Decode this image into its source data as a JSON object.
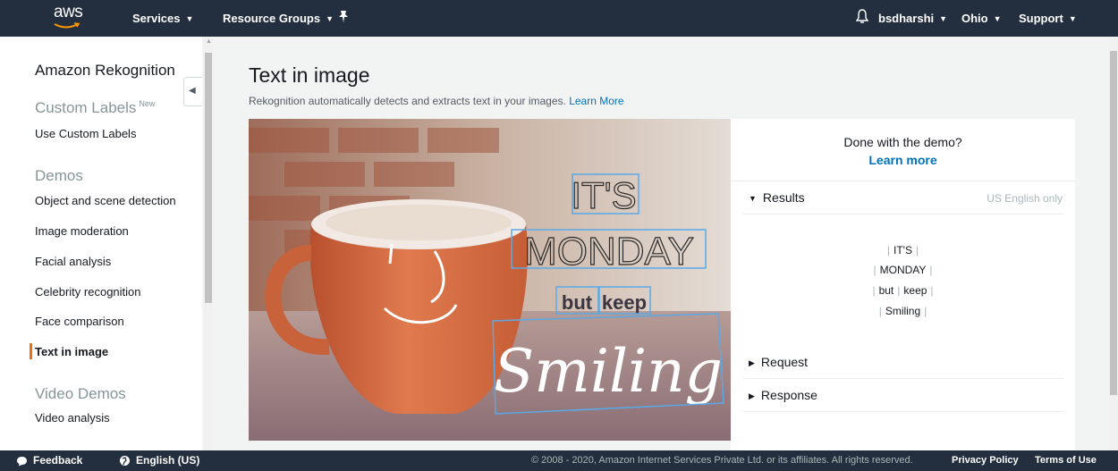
{
  "nav": {
    "logo_text": "aws",
    "services": "Services",
    "resource_groups": "Resource Groups",
    "user": "bsdharshi",
    "region": "Ohio",
    "support": "Support"
  },
  "sidebar": {
    "title": "Amazon Rekognition",
    "custom_labels_header": "Custom Labels",
    "custom_labels_badge": "New",
    "use_custom_labels": "Use Custom Labels",
    "demos_header": "Demos",
    "demos": [
      "Object and scene detection",
      "Image moderation",
      "Facial analysis",
      "Celebrity recognition",
      "Face comparison",
      "Text in image"
    ],
    "video_demos_header": "Video Demos",
    "video_analysis": "Video analysis"
  },
  "main": {
    "title": "Text in image",
    "description": "Rekognition automatically detects and extracts text in your images.",
    "learn_more": "Learn More"
  },
  "image_text": {
    "line1": "IT'S",
    "line2": "MONDAY",
    "word3a": "but",
    "word3b": "keep",
    "line4": "Smiling"
  },
  "panel": {
    "done_question": "Done with the demo?",
    "done_link": "Learn more",
    "results_label": "Results",
    "language_note": "US English only",
    "results": [
      "IT'S",
      "MONDAY",
      "but",
      "keep",
      "Smiling"
    ],
    "request_label": "Request",
    "response_label": "Response"
  },
  "footer": {
    "feedback": "Feedback",
    "language": "English (US)",
    "copyright": "© 2008 - 2020, Amazon Internet Services Private Ltd. or its affiliates. All rights reserved.",
    "privacy": "Privacy Policy",
    "terms": "Terms of Use"
  },
  "colors": {
    "nav_bg": "#232f3e",
    "link": "#0073bb",
    "active_bar": "#ec7211",
    "bounding_box": "#5aa9e6"
  }
}
